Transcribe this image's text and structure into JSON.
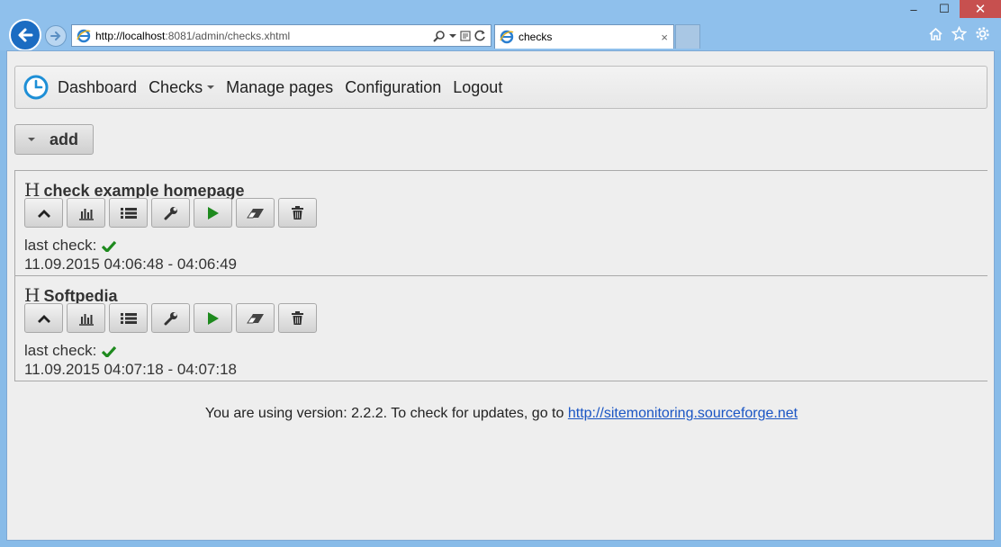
{
  "browser": {
    "url_host": "http://localhost",
    "url_rest": ":8081/admin/checks.xhtml",
    "tab_title": "checks",
    "tab_close": "×",
    "window_controls": [
      "–",
      "☐",
      "✕"
    ]
  },
  "navbar": {
    "items": [
      {
        "label": "Dashboard"
      },
      {
        "label": "Checks",
        "has_caret": true
      },
      {
        "label": "Manage pages"
      },
      {
        "label": "Configuration"
      },
      {
        "label": "Logout"
      }
    ]
  },
  "add_button": {
    "label": "add"
  },
  "checks": [
    {
      "name": "check example homepage",
      "last_label": "last check:",
      "time": "11.09.2015 04:06:48 - 04:06:49"
    },
    {
      "name": "Softpedia",
      "last_label": "last check:",
      "time": "11.09.2015 04:07:18 - 04:07:18"
    }
  ],
  "footer": {
    "text": "You are using version: 2.2.2. To check for updates, go to ",
    "link": "http://sitemonitoring.sourceforge.net"
  },
  "colors": {
    "accent": "#1e8fd6",
    "success": "#1e8a1e",
    "link": "#1a55c4"
  },
  "icons": [
    "back-icon",
    "forward-icon",
    "ie-icon",
    "search-icon",
    "refresh-icon",
    "home-icon",
    "star-icon",
    "gear-icon",
    "clock-icon",
    "chevron-up-icon",
    "chart-icon",
    "list-icon",
    "wrench-icon",
    "play-icon",
    "eraser-icon",
    "trash-icon",
    "check-icon"
  ]
}
